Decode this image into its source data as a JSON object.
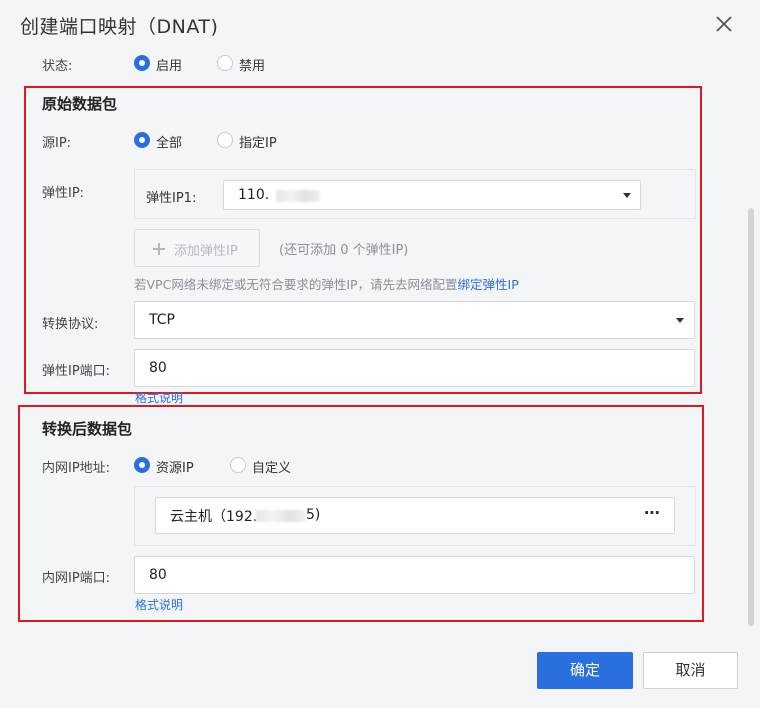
{
  "dialog": {
    "title": "创建端口映射（DNAT)",
    "status_label": "状态:",
    "status_options": [
      "启用",
      "禁用"
    ],
    "original": {
      "title": "原始数据包",
      "source_ip_label": "源IP:",
      "source_ip_options": [
        "全部",
        "指定IP"
      ],
      "eip_label": "弹性IP:",
      "eip1_label": "弹性IP1:",
      "eip1_value": "110.",
      "add_eip_button": "添加弹性IP",
      "add_eip_hint": "(还可添加 0 个弹性IP)",
      "note": "若VPC网络未绑定或无符合要求的弹性IP，请先去网络配置",
      "note_link": "绑定弹性IP",
      "protocol_label": "转换协议:",
      "protocol_value": "TCP",
      "eip_port_label": "弹性IP端口:",
      "eip_port_value": "80",
      "format_link": "格式说明"
    },
    "translated": {
      "title": "转换后数据包",
      "inner_ip_label": "内网IP地址:",
      "inner_ip_options": [
        "资源IP",
        "自定义"
      ],
      "host_value": "云主机（192.",
      "host_suffix": "5)",
      "more_icon": "more-icon",
      "inner_port_label": "内网IP端口:",
      "inner_port_value": "80",
      "format_link": "格式说明"
    },
    "confirm_button": "确定",
    "cancel_button": "取消"
  },
  "colors": {
    "primary": "#2a6fe0",
    "highlight_border": "#e0191e"
  }
}
